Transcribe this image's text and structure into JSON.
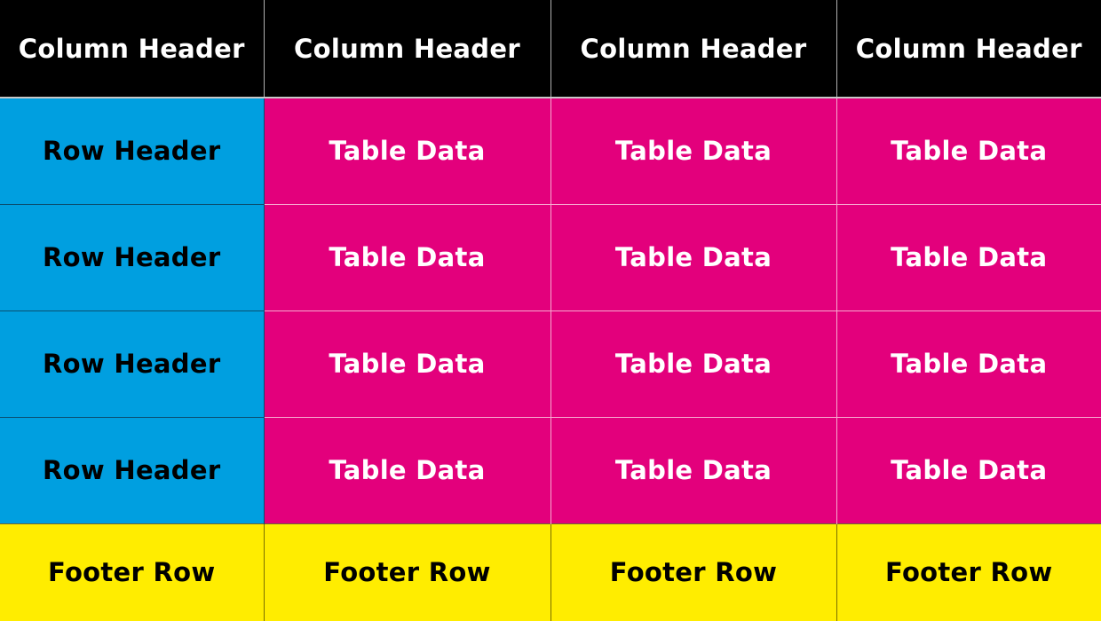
{
  "table": {
    "column_headers": [
      "Column Header",
      "Column Header",
      "Column Header",
      "Column Header"
    ],
    "rows": [
      {
        "header": "Row Header",
        "cells": [
          "Table Data",
          "Table Data",
          "Table Data"
        ]
      },
      {
        "header": "Row Header",
        "cells": [
          "Table Data",
          "Table Data",
          "Table Data"
        ]
      },
      {
        "header": "Row Header",
        "cells": [
          "Table Data",
          "Table Data",
          "Table Data"
        ]
      },
      {
        "header": "Row Header",
        "cells": [
          "Table Data",
          "Table Data",
          "Table Data"
        ]
      }
    ],
    "footer": [
      "Footer Row",
      "Footer Row",
      "Footer Row",
      "Footer Row"
    ]
  },
  "colors": {
    "column_header_bg": "#000000",
    "row_header_bg": "#009fe0",
    "data_bg": "#e3007c",
    "footer_bg": "#ffed00"
  }
}
